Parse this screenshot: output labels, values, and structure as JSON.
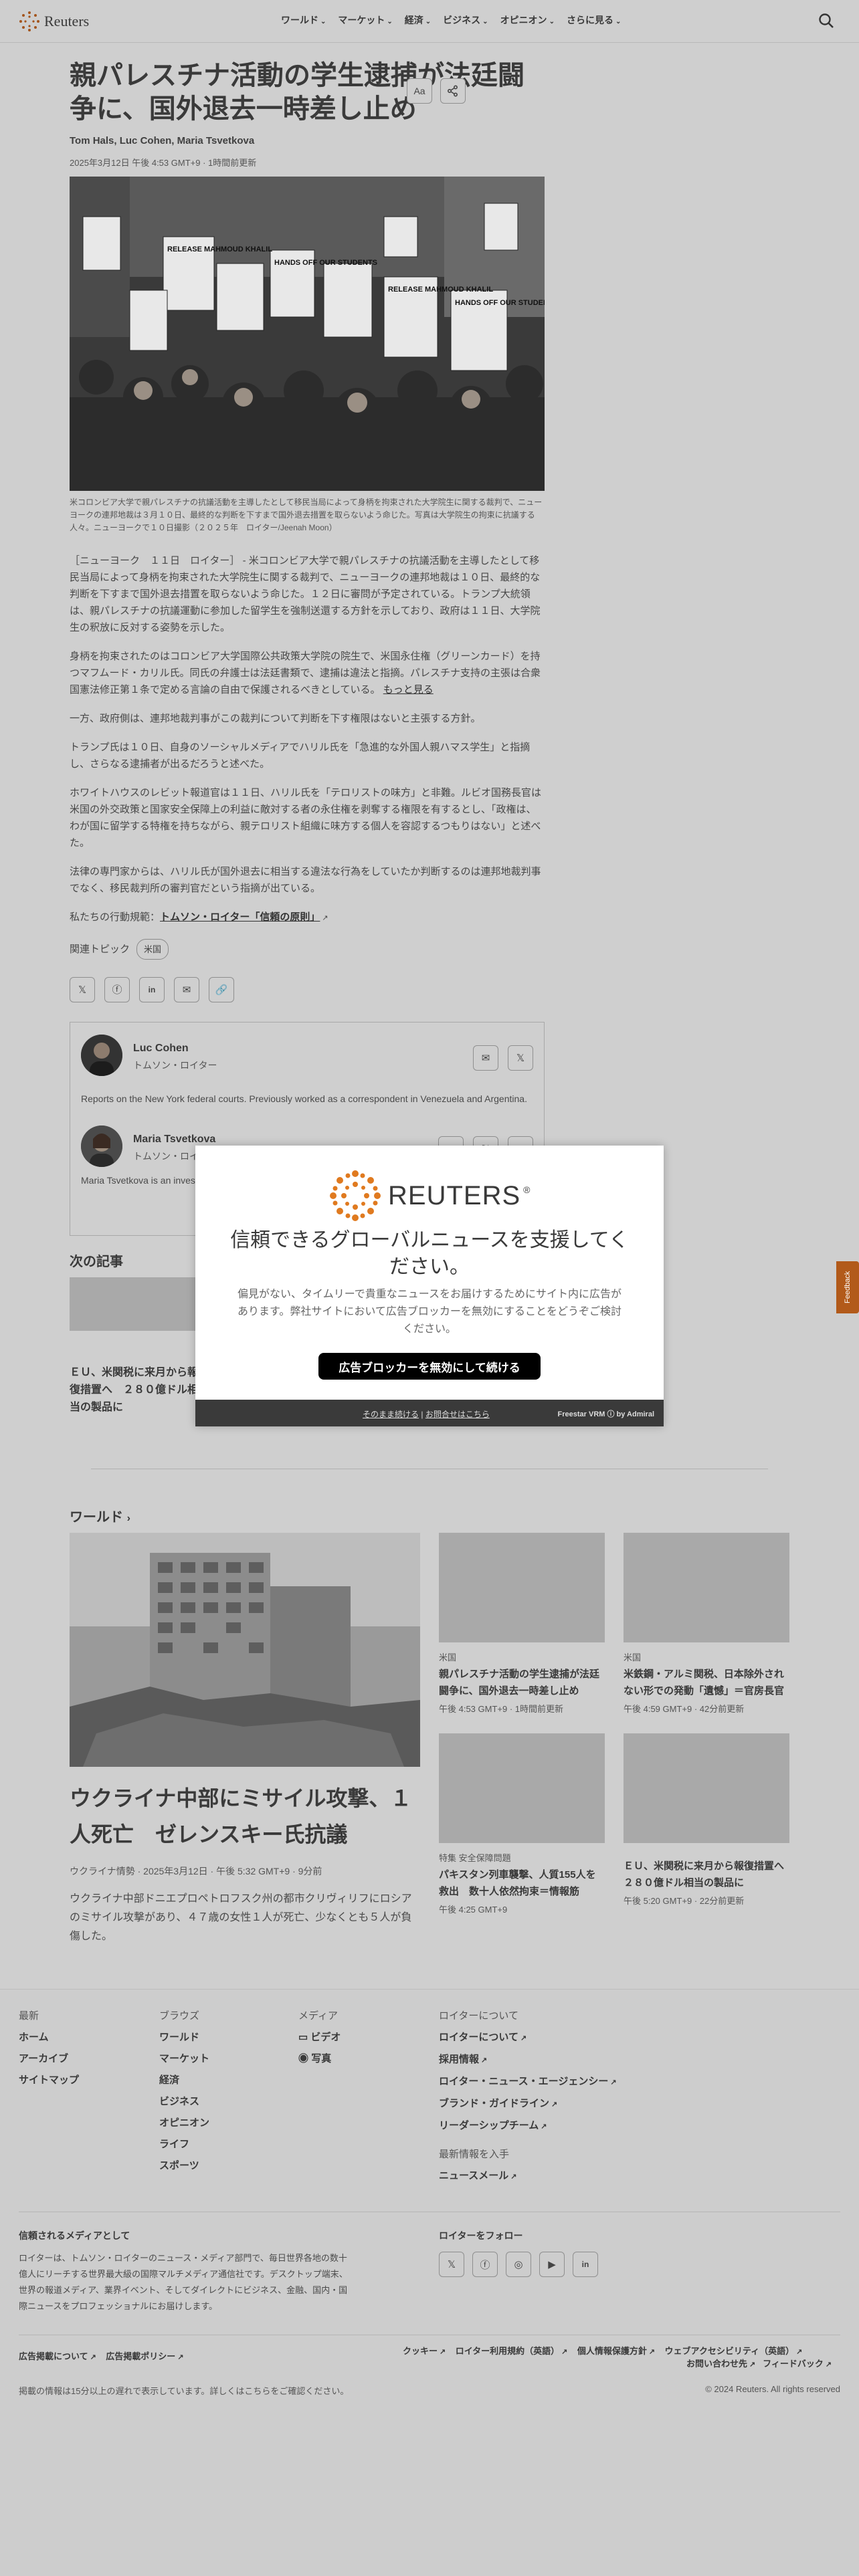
{
  "header": {
    "brand": "Reuters",
    "nav": [
      "ワールド",
      "マーケット",
      "経済",
      "ビジネス",
      "オピニオン",
      "さらに見る"
    ]
  },
  "article": {
    "title": "親パレスチナ活動の学生逮捕が法廷闘争に、国外退去一時差し止め",
    "authors": "Tom Hals, Luc Cohen, Maria Tsvetkova",
    "date": "2025年3月12日 午後 4:53 GMT+9 · 1時間前更新",
    "font_tool": "Aa",
    "photo_signs": [
      "RELEASE MAHMOUD KHALIL",
      "HANDS OFF OUR STUDENTS",
      "RELEASE MAHMOUD KHALIL",
      "HANDS OFF OUR STUDENTS ICE OFF"
    ],
    "caption": "米コロンビア大学で親パレスチナの抗議活動を主導したとして移民当局によって身柄を拘束された大学院生に関する裁判で、ニューヨークの連邦地裁は３月１０日、最終的な判断を下すまで国外退去措置を取らないよう命じた。写真は大学院生の拘束に抗議する人々。ニューヨークで１０日撮影（２０２５年　ロイター/Jeenah Moon）",
    "paragraphs": [
      "［ニューヨーク　１１日　ロイター］ - 米コロンビア大学で親パレスチナの抗議活動を主導したとして移民当局によって身柄を拘束された大学院生に関する裁判で、ニューヨークの連邦地裁は１０日、最終的な判断を下すまで国外退去措置を取らないよう命じた。１２日に審問が予定されている。トランプ大統領は、親パレスチナの抗議運動に参加した留学生を強制送還する方針を示しており、政府は１１日、大学院生の釈放に反対する姿勢を示した。",
      "一方、政府側は、連邦地裁判事がこの裁判について判断を下す権限はないと主張する方針。",
      "トランプ氏は１０日、自身のソーシャルメディアでハリル氏を「急進的な外国人親ハマス学生」と指摘し、さらなる逮捕者が出るだろうと述べた。",
      "ホワイトハウスのレビット報道官は１１日、ハリル氏を「テロリストの味方」と非難。ルビオ国務長官は米国の外交政策と国家安全保障上の利益に敵対する者の永住権を剥奪する権限を有するとし、「政権は、わが国に留学する特権を持ちながら、親テロリスト組織に味方する個人を容認するつもりはない」と述べた。",
      "法律の専門家からは、ハリル氏が国外退去に相当する違法な行為をしていたか判断するのは連邦地裁判事でなく、移民裁判所の審判官だという指摘が出ている。"
    ],
    "para2": "身柄を拘束されたのはコロンビア大学国際公共政策大学院の院生で、米国永住権（グリーンカード）を持つマフムード・カリル氏。同氏の弁護士は法廷書類で、逮捕は違法と指摘。パレスチナ支持の主張は合衆国憲法修正第１条で定める言論の自由で保護されるべきとしている。",
    "read_more": "もっと見る",
    "principle_prefix": "私たちの行動規範：",
    "principle_link": "トムソン・ロイター「信頼の原則」",
    "topics_label": "関連トピック",
    "topic": "米国"
  },
  "authors_box": [
    {
      "name": "Luc Cohen",
      "role": "トムソン・ロイター",
      "bio": "Reports on the New York federal courts. Previously worked as a correspondent in Venezuela and Argentina."
    },
    {
      "name": "Maria Tsvetkova",
      "role": "トムソン・ロイター",
      "bio": "Maria Tsvetkova is an investigative reporter ... Ukraine as part of an int... in Ukraine and Nagorno-..."
    }
  ],
  "next": {
    "heading": "次の記事",
    "item": "ＥＵ、米関税に来月から報復措置へ　２８０億ドル相当の製品に"
  },
  "world": {
    "heading": "ワールド",
    "main_title": "ウクライナ中部にミサイル攻撃、１人死亡　ゼレンスキー氏抗議",
    "main_meta": "ウクライナ情勢 · 2025年3月12日 · 午後 5:32 GMT+9 · 9分前",
    "main_desc": "ウクライナ中部ドニエプロペトロフスク州の都市クリヴィリフにロシアのミサイル攻撃があり、４７歳の女性１人が死亡、少なくとも５人が負傷した。",
    "cards": [
      {
        "tag": "米国",
        "title": "親パレスチナ活動の学生逮捕が法廷闘争に、国外退去一時差し止め",
        "meta": "午後 4:53 GMT+9 · 1時間前更新"
      },
      {
        "tag": "米国",
        "title": "米鉄鋼・アルミ関税、日本除外されない形での発動「遺憾」＝官房長官",
        "meta": "午後 4:59 GMT+9 · 42分前更新"
      },
      {
        "tag": "特集 安全保障問題",
        "title": "パキスタン列車襲撃、人質155人を救出　数十人依然拘束＝情報筋",
        "meta": "午後 4:25 GMT+9"
      },
      {
        "tag": "",
        "title": "ＥＵ、米関税に来月から報復措置へ　２８０億ドル相当の製品に",
        "meta": "午後 5:20 GMT+9 · 22分前更新"
      }
    ]
  },
  "footer": {
    "col1": {
      "heading": "最新",
      "items": [
        "ホーム",
        "アーカイブ",
        "サイトマップ"
      ]
    },
    "col2": {
      "heading": "ブラウズ",
      "items": [
        "ワールド",
        "マーケット",
        "経済",
        "ビジネス",
        "オピニオン",
        "ライフ",
        "スポーツ"
      ]
    },
    "col3": {
      "heading": "メディア",
      "items": [
        "ビデオ",
        "写真"
      ]
    },
    "col4": {
      "heading": "ロイターについて",
      "items": [
        "ロイターについて",
        "採用情報",
        "ロイター・ニュース・エージェンシー",
        "ブランド・ガイドライン",
        "リーダーシップチーム"
      ]
    },
    "col5": {
      "heading": "最新情報を入手",
      "items": [
        "ニュースメール"
      ]
    },
    "trust_heading": "信頼されるメディアとして",
    "trust_text": "ロイターは、トムソン・ロイターのニュース・メディア部門で、毎日世界各地の数十億人にリーチする世界最大級の国際マルチメディア通信社です。デスクトップ端末、世界の報道メディア、業界イベント、そしてダイレクトにビジネス、金融、国内・国際ニュースをプロフェッショナルにお届けします。",
    "follow_heading": "ロイターをフォロー",
    "legal_left": [
      "広告掲載について",
      "広告掲載ポリシー"
    ],
    "legal_right": [
      "クッキー",
      "ロイター利用規約（英語）",
      "個人情報保護方針",
      "ウェブアクセシビリティ（英語）",
      "お問い合わせ先",
      "フィードバック"
    ],
    "disclaimer": "掲載の情報は15分以上の遅れで表示しています。詳しくはこちらをご確認ください。",
    "copyright": "© 2024 Reuters. All rights reserved"
  },
  "feedback_tab": "Feedback",
  "modal": {
    "brand": "REUTERS",
    "headline": "信頼できるグローバルニュースを支援してください。",
    "body": "偏見がない、タイムリーで貴重なニュースをお届けするためにサイト内に広告があります。弊社サイトにおいて広告ブロッカーを無効にすることをどうぞご検討ください。",
    "button": "広告ブロッカーを無効にして続ける",
    "link1": "そのまま続ける",
    "link2": "お問合せはこちら",
    "credit": "Freestar VRM ⓘ by Admiral"
  }
}
